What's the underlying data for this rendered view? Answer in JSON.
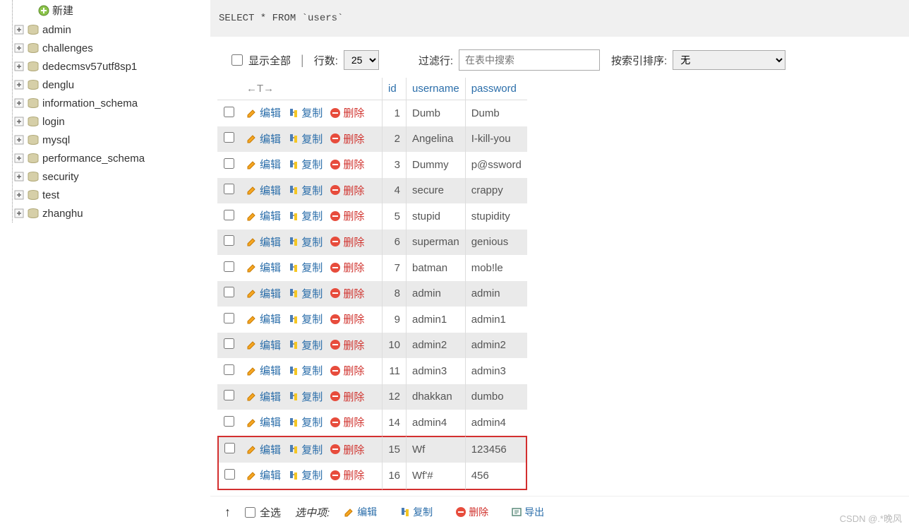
{
  "sidebar": {
    "new_label": "新建",
    "databases": [
      "admin",
      "challenges",
      "dedecmsv57utf8sp1",
      "denglu",
      "information_schema",
      "login",
      "mysql",
      "performance_schema",
      "security",
      "test",
      "zhanghu"
    ]
  },
  "sql": "SELECT * FROM `users`",
  "controls": {
    "show_all": "显示全部",
    "rows_label": "行数:",
    "rows_value": "25",
    "filter_label": "过滤行:",
    "filter_placeholder": "在表中搜索",
    "sort_label": "按索引排序:",
    "sort_value": "无"
  },
  "table": {
    "headers": {
      "id": "id",
      "username": "username",
      "password": "password"
    },
    "sort_arrows": "←T→",
    "actions": {
      "edit": "编辑",
      "copy": "复制",
      "delete": "删除"
    },
    "rows": [
      {
        "id": "1",
        "username": "Dumb",
        "password": "Dumb",
        "hl": false
      },
      {
        "id": "2",
        "username": "Angelina",
        "password": "I-kill-you",
        "hl": false
      },
      {
        "id": "3",
        "username": "Dummy",
        "password": "p@ssword",
        "hl": false
      },
      {
        "id": "4",
        "username": "secure",
        "password": "crappy",
        "hl": false
      },
      {
        "id": "5",
        "username": "stupid",
        "password": "stupidity",
        "hl": false
      },
      {
        "id": "6",
        "username": "superman",
        "password": "genious",
        "hl": false
      },
      {
        "id": "7",
        "username": "batman",
        "password": "mob!le",
        "hl": false
      },
      {
        "id": "8",
        "username": "admin",
        "password": "admin",
        "hl": false
      },
      {
        "id": "9",
        "username": "admin1",
        "password": "admin1",
        "hl": false
      },
      {
        "id": "10",
        "username": "admin2",
        "password": "admin2",
        "hl": false
      },
      {
        "id": "11",
        "username": "admin3",
        "password": "admin3",
        "hl": false
      },
      {
        "id": "12",
        "username": "dhakkan",
        "password": "dumbo",
        "hl": false
      },
      {
        "id": "14",
        "username": "admin4",
        "password": "admin4",
        "hl": false
      },
      {
        "id": "15",
        "username": "Wf",
        "password": "123456",
        "hl": true,
        "hl_top": true
      },
      {
        "id": "16",
        "username": "Wf'#",
        "password": "456",
        "hl": true,
        "hl_bot": true
      }
    ]
  },
  "footer": {
    "select_all": "全选",
    "selected_items": "选中项:",
    "edit": "编辑",
    "copy": "复制",
    "delete": "删除",
    "export": "导出"
  },
  "watermark": "CSDN @.*晚风"
}
